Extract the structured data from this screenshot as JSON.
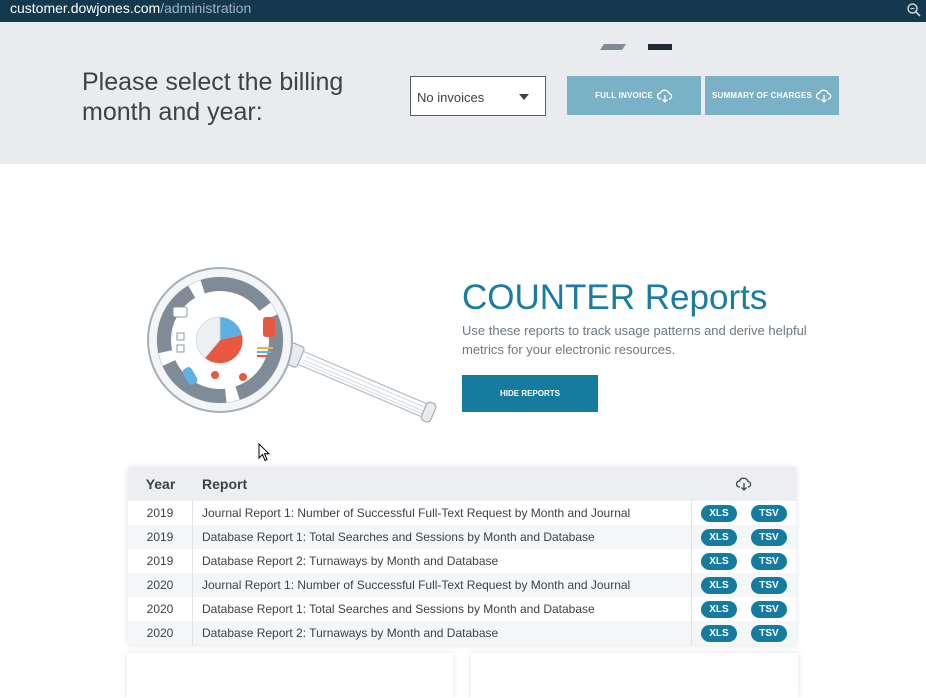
{
  "browser": {
    "url_host": "customer.dowjones.com",
    "url_path": "/administration",
    "zoom_icon": "zoom-icon"
  },
  "billing": {
    "prompt": "Please select the billing month and year:",
    "select_value": "No invoices",
    "full_invoice_label": "FULL INVOICE",
    "summary_label": "SUMMARY OF CHARGES",
    "button_color": "#7bb1c6",
    "band_color": "#e9ebee"
  },
  "counter": {
    "title": "COUNTER Reports",
    "description": "Use these reports to track usage patterns and derive helpful metrics for your electronic resources.",
    "hide_label": "HIDE REPORTS",
    "accent_color": "#167c9f"
  },
  "table": {
    "headers": {
      "year": "Year",
      "report": "Report",
      "download_icon": "cloud-download-icon"
    },
    "rows": [
      {
        "year": "2019",
        "report": "Journal Report 1: Number of Successful Full-Text Request by Month and Journal",
        "xls": "XLS",
        "tsv": "TSV"
      },
      {
        "year": "2019",
        "report": "Database Report 1: Total Searches and Sessions by Month and Database",
        "xls": "XLS",
        "tsv": "TSV"
      },
      {
        "year": "2019",
        "report": "Database Report 2: Turnaways by Month and Database",
        "xls": "XLS",
        "tsv": "TSV"
      },
      {
        "year": "2020",
        "report": "Journal Report 1: Number of Successful Full-Text Request by Month and Journal",
        "xls": "XLS",
        "tsv": "TSV"
      },
      {
        "year": "2020",
        "report": "Database Report 1: Total Searches and Sessions by Month and Database",
        "xls": "XLS",
        "tsv": "TSV"
      },
      {
        "year": "2020",
        "report": "Database Report 2: Turnaways by Month and Database",
        "xls": "XLS",
        "tsv": "TSV"
      }
    ]
  }
}
